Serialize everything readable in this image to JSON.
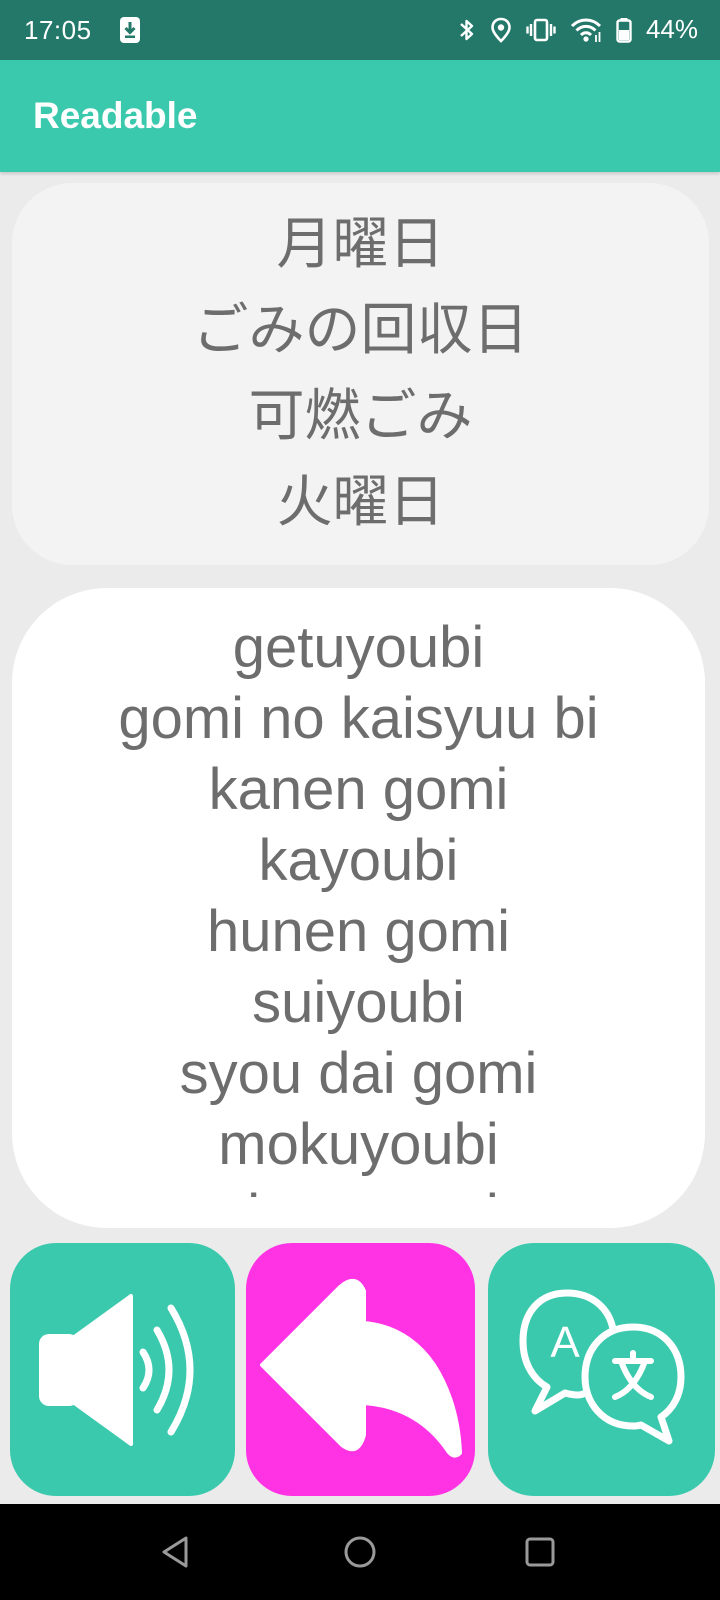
{
  "status_bar": {
    "time": "17:05",
    "battery": "44%",
    "icons": [
      "download-icon",
      "bluetooth-icon",
      "location-icon",
      "vibrate-icon",
      "wifi-icon",
      "battery-icon"
    ]
  },
  "app_bar": {
    "title": "Readable"
  },
  "japanese_text": {
    "lines": [
      "月曜日",
      "ごみの回収日",
      "可燃ごみ",
      "火曜日"
    ]
  },
  "romaji_text": {
    "lines": [
      "getuyoubi",
      "gomi no kaisyuu bi",
      "kanen gomi",
      "kayoubi",
      "hunen gomi",
      "suiyoubi",
      "syou dai gomi",
      "mokuyoubi",
      "sigen gomi"
    ]
  },
  "buttons": {
    "speak": {
      "icon": "speaker-icon",
      "color": "#3bc9ae"
    },
    "back": {
      "icon": "back-arrow-icon",
      "color": "#ff33e3"
    },
    "translate": {
      "icon": "translate-icon",
      "color": "#3bc9ae"
    }
  },
  "nav_bar": {
    "icons": [
      "nav-back-icon",
      "nav-home-icon",
      "nav-recents-icon"
    ]
  },
  "colors": {
    "status_bar": "#24786a",
    "accent": "#3bc9ae",
    "back_button": "#ff33e3",
    "text": "#6d6d6d"
  }
}
